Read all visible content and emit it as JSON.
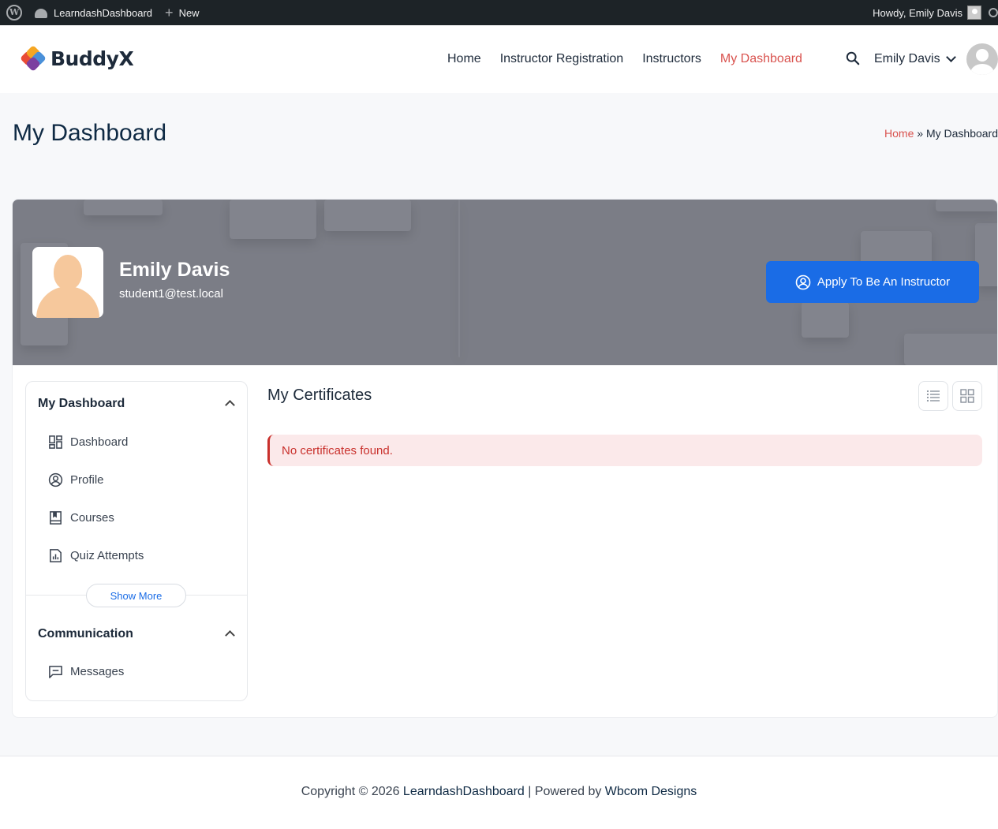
{
  "adminbar": {
    "site_name": "LearndashDashboard",
    "new_label": "New",
    "howdy": "Howdy, Emily Davis"
  },
  "header": {
    "logo_text": "BuddyX",
    "nav": [
      {
        "label": "Home"
      },
      {
        "label": "Instructor Registration"
      },
      {
        "label": "Instructors"
      },
      {
        "label": "My Dashboard",
        "active": true
      }
    ],
    "user_name": "Emily Davis"
  },
  "page": {
    "title": "My Dashboard",
    "breadcrumb_home": "Home",
    "breadcrumb_sep": "»",
    "breadcrumb_current": "My Dashboard"
  },
  "profile": {
    "name": "Emily Davis",
    "email": "student1@test.local",
    "apply_label": "Apply To Be An Instructor"
  },
  "sidebar": {
    "section1_title": "My Dashboard",
    "items": [
      {
        "label": "Dashboard",
        "icon": "dashboard-icon"
      },
      {
        "label": "Profile",
        "icon": "profile-icon"
      },
      {
        "label": "Courses",
        "icon": "book-icon"
      },
      {
        "label": "Quiz Attempts",
        "icon": "report-icon"
      }
    ],
    "show_more": "Show More",
    "section2_title": "Communication",
    "messages_label": "Messages"
  },
  "content": {
    "title": "My Certificates",
    "notice": "No certificates found."
  },
  "footer": {
    "prefix": "Copyright © 2026 ",
    "site_link": "LearndashDashboard",
    "middle": " | Powered by ",
    "powered_link": "Wbcom Designs"
  },
  "colors": {
    "accent": "#d9534f",
    "primary_button": "#1a6ce6",
    "admin_bar": "#1d2327",
    "notice_bg": "#fbe9ea"
  }
}
